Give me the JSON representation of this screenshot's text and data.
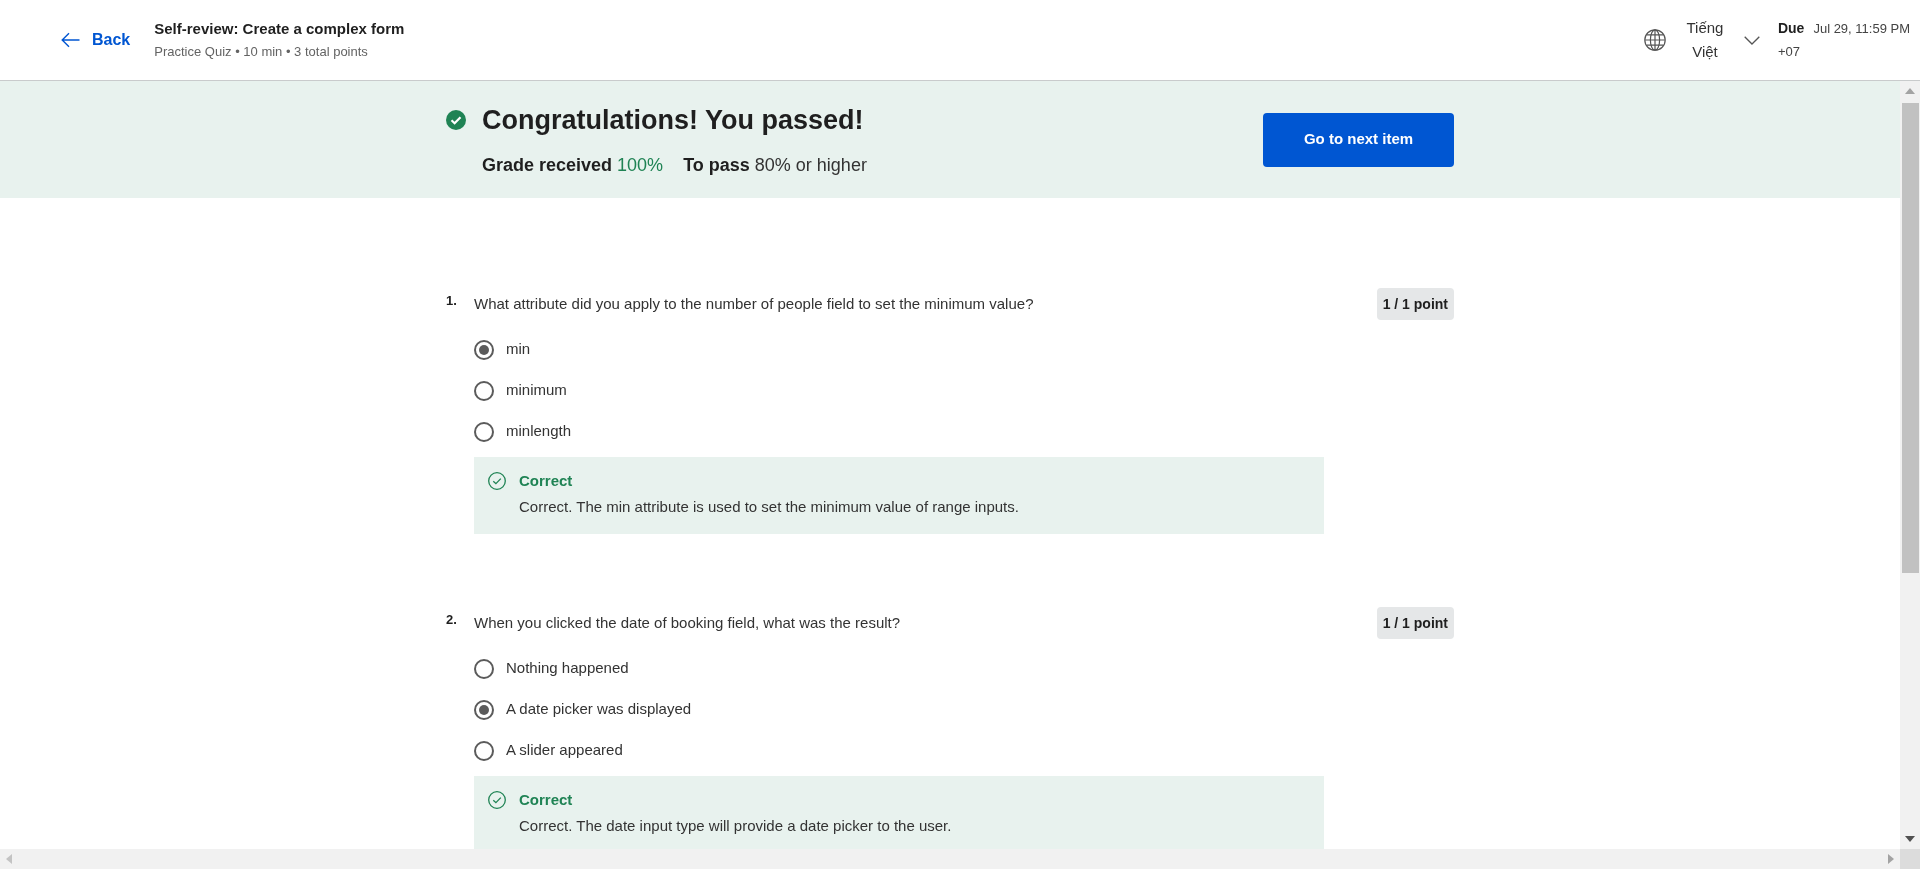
{
  "header": {
    "back": "Back",
    "title": "Self-review: Create a complex form",
    "details": "Practice Quiz • 10 min • 3 total points",
    "language": "Tiếng Việt",
    "due_label": "Due",
    "due_date": "Jul 29, 11:59 PM",
    "timezone": "+07"
  },
  "result": {
    "passed": true,
    "title": "Congratulations! You passed!",
    "grade_label": "Grade received",
    "grade_value": "100%",
    "pass_label": "To pass",
    "pass_value": "80% or higher",
    "button": "Go to next item"
  },
  "questions": [
    {
      "number": "1.",
      "text": "What attribute did you apply to the number of people field to set the minimum value?",
      "points": "1 / 1 point",
      "options": [
        {
          "label": "min",
          "selected": true
        },
        {
          "label": "minimum",
          "selected": false
        },
        {
          "label": "minlength",
          "selected": false
        }
      ],
      "feedback": {
        "kind": "correct",
        "title": "Correct",
        "text": "Correct. The min attribute is used to set the minimum value of range inputs."
      }
    },
    {
      "number": "2.",
      "text": "When you clicked the date of booking field, what was the result?",
      "points": "1 / 1 point",
      "options": [
        {
          "label": "Nothing happened",
          "selected": false
        },
        {
          "label": "A date picker was displayed",
          "selected": true
        },
        {
          "label": "A slider appeared",
          "selected": false
        }
      ],
      "feedback": {
        "kind": "correct",
        "title": "Correct",
        "text": "Correct. The date input type will provide a date picker to the user."
      }
    }
  ]
}
